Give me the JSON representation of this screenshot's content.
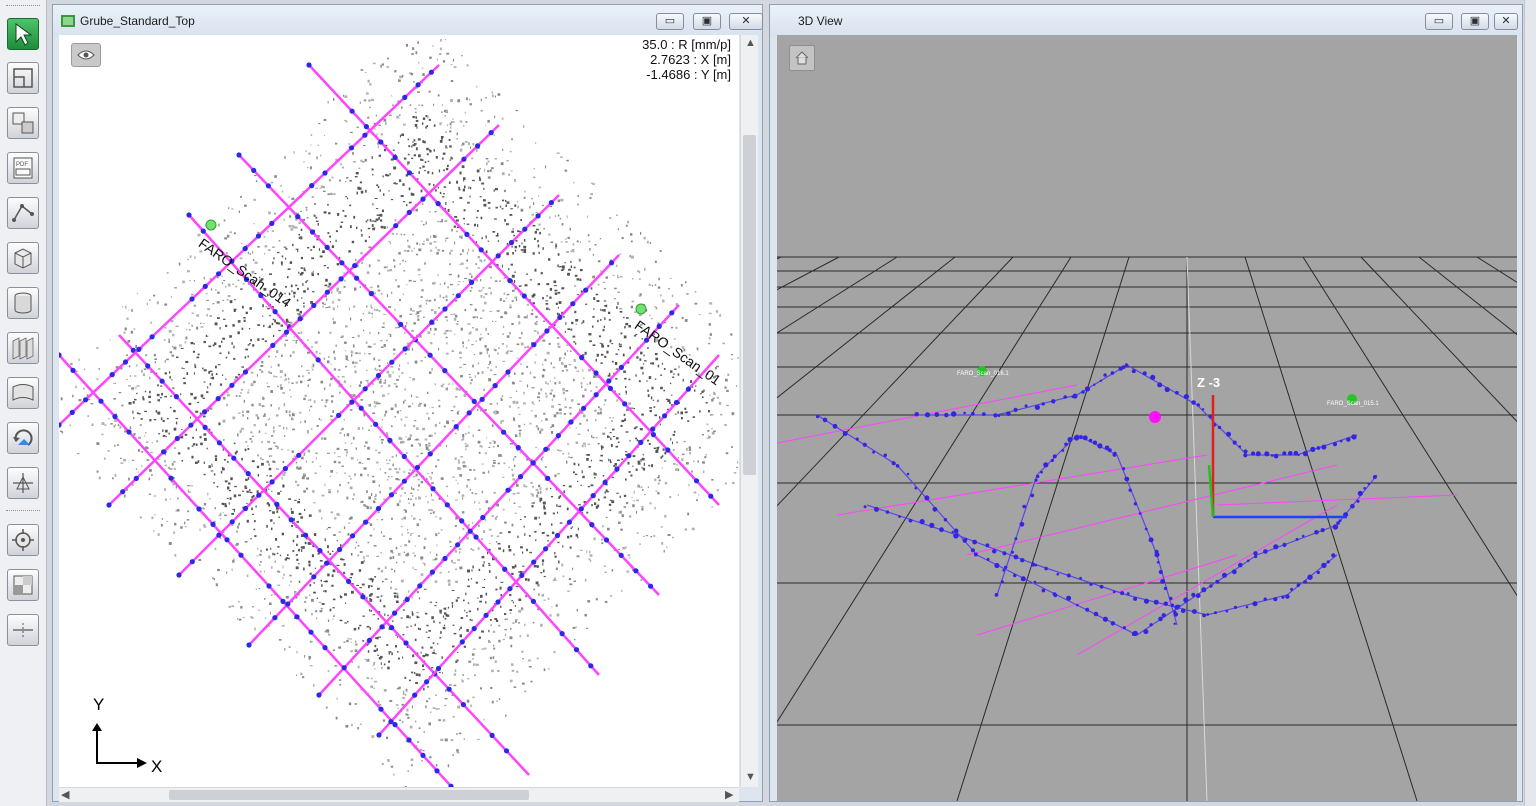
{
  "toolbar": {
    "tools": [
      "select-arrow-icon",
      "layout-icon",
      "tile-views-icon",
      "pdf-export-icon",
      "polyline-icon",
      "box-icon",
      "cylinder-icon",
      "section-planes-icon",
      "surface-icon",
      "rotate-icon",
      "align-icon",
      "target-icon",
      "quadrant-icon",
      "cut-plane-icon"
    ]
  },
  "top_view": {
    "title": "Grube_Standard_Top",
    "readout": {
      "radius_line": "35.0 : R [mm/p]",
      "x_line": "2.7623 : X [m]",
      "y_line": "-1.4686 : Y [m]"
    },
    "scan_labels": [
      "FARO_Scan_014",
      "FARO_Scan_01"
    ],
    "axis_y": "Y",
    "axis_x": "X",
    "buttons": {
      "minimize": "▭",
      "restore": "▣",
      "close": "✕"
    }
  },
  "view_3d": {
    "title": "3D View",
    "axis_label": "Z -3",
    "scan_labels": [
      "FARO_Scan_016.1",
      "FARO_Scan_015.1"
    ],
    "buttons": {
      "minimize": "▭",
      "restore": "▣",
      "close": "✕"
    }
  },
  "colors": {
    "profile_line": "#ff44ff",
    "profile_point": "#2a2ae6",
    "scan_marker": "#6fe36f",
    "grid_bg": "#a4a4a4",
    "axis_z": "#e02020",
    "axis_x": "#2040ff",
    "axis_y": "#20c020"
  }
}
